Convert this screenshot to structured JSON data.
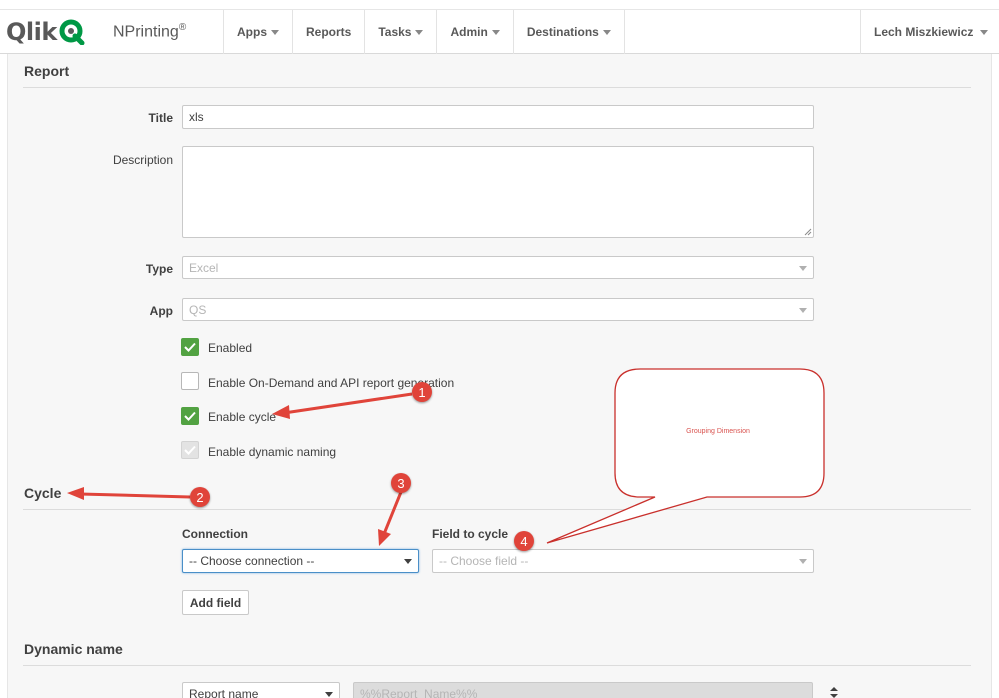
{
  "brand": {
    "logo_text": "Qlik",
    "product": "NPrinting",
    "product_mark": "®"
  },
  "nav": {
    "items": [
      {
        "label": "Apps",
        "has_caret": true
      },
      {
        "label": "Reports",
        "has_caret": false
      },
      {
        "label": "Tasks",
        "has_caret": true
      },
      {
        "label": "Admin",
        "has_caret": true
      },
      {
        "label": "Destinations",
        "has_caret": true
      }
    ],
    "user": "Lech Miszkiewicz"
  },
  "report": {
    "section_title": "Report",
    "title_label": "Title",
    "title_value": "xls",
    "description_label": "Description",
    "description_value": "",
    "type_label": "Type",
    "type_value": "Excel",
    "app_label": "App",
    "app_value": "QS",
    "checkboxes": [
      {
        "label": "Enabled",
        "checked": true,
        "disabled": false
      },
      {
        "label": "Enable On-Demand and API report generation",
        "checked": false,
        "disabled": false
      },
      {
        "label": "Enable cycle",
        "checked": true,
        "disabled": false
      },
      {
        "label": "Enable dynamic naming",
        "checked": true,
        "disabled": true
      }
    ]
  },
  "cycle": {
    "section_title": "Cycle",
    "connection_label": "Connection",
    "connection_value": "-- Choose connection --",
    "field_label": "Field to cycle",
    "field_placeholder": "-- Choose field --",
    "add_field_label": "Add field"
  },
  "dynamic_name": {
    "section_title": "Dynamic name",
    "select_value": "Report name",
    "value": "%%Report_Name%%"
  },
  "annotations": {
    "callout_text": "Grouping Dimension",
    "numbers": [
      "1",
      "2",
      "3",
      "4"
    ],
    "color": "#e0443a"
  },
  "colors": {
    "checkbox_green": "#52a242",
    "qlik_green": "#009845"
  }
}
